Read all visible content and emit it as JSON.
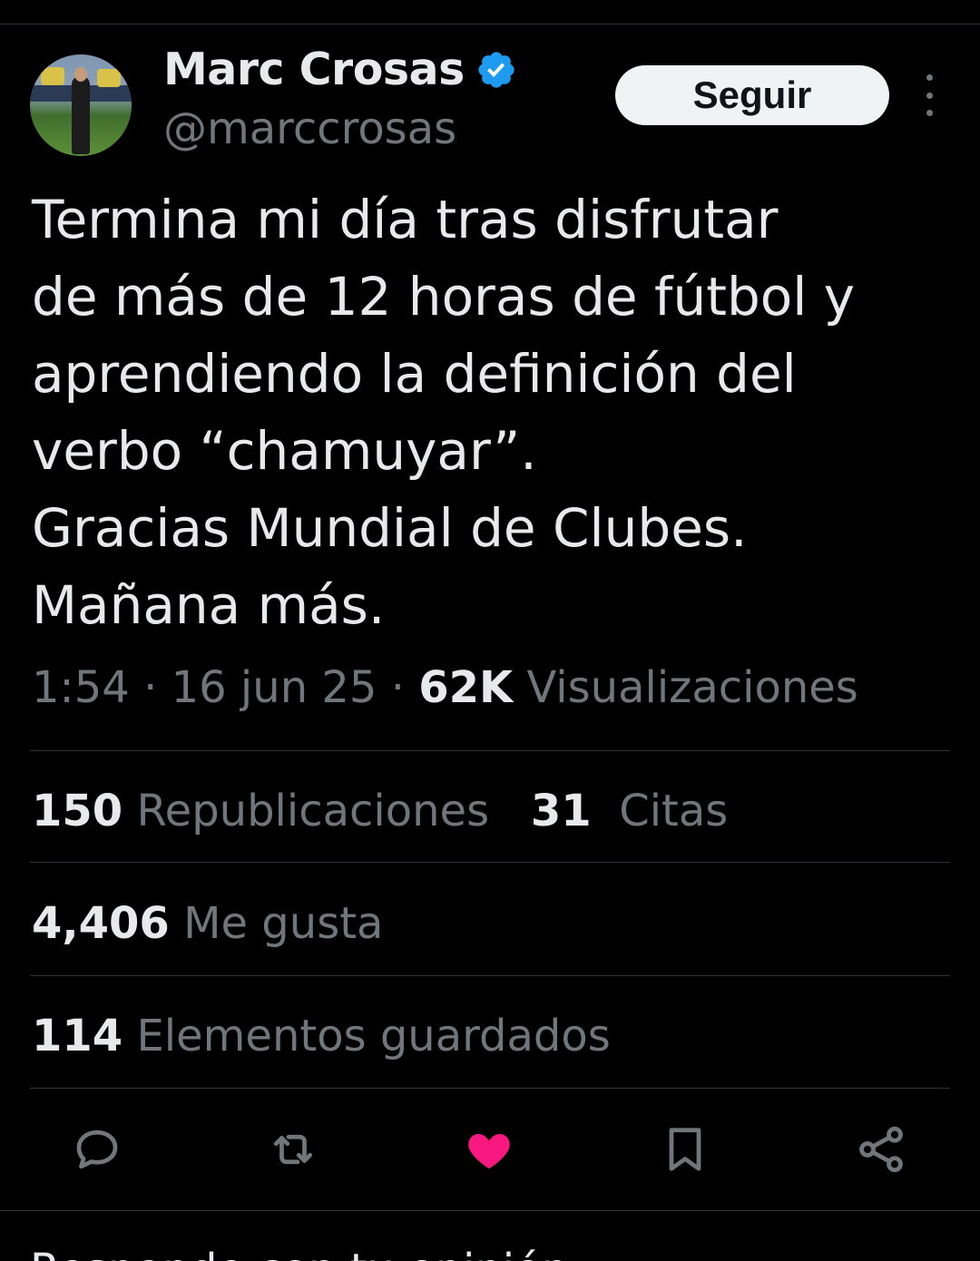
{
  "author": {
    "display_name": "Marc Crosas",
    "handle": "@marccrosas",
    "verified_color": "#1d9bf0"
  },
  "follow_button": {
    "label": "Seguir"
  },
  "more_menu_icon": "more-vertical-icon",
  "tweet": {
    "text": "Termina mi día tras disfrutar\nde más de 12 horas de fútbol y\naprendiendo la definición del\nverbo “chamuyar”.\nGracias Mundial de Clubes.\nMañana más."
  },
  "meta": {
    "time": "1:54",
    "separator": "·",
    "date": "16 jun 25",
    "views_count": "62K",
    "views_label": "Visualizaciones"
  },
  "stats": {
    "reposts_count": "150",
    "reposts_label": "Republicaciones",
    "quotes_count": "31",
    "quotes_label": "Citas",
    "likes_count": "4,406",
    "likes_label": "Me gusta",
    "bookmarks_count": "114",
    "bookmarks_label": "Elementos guardados"
  },
  "actions": [
    {
      "icon": "reply-icon"
    },
    {
      "icon": "repost-icon"
    },
    {
      "icon": "like-icon",
      "active_color": "#f91880"
    },
    {
      "icon": "bookmark-icon"
    },
    {
      "icon": "share-icon"
    }
  ],
  "reply_prompt": {
    "text": "Responde con tu opinión"
  },
  "colors": {
    "background": "#000000",
    "primary_text": "#e7e9ea",
    "secondary_text": "#71767b",
    "divider": "#2f3336",
    "like": "#f91880"
  }
}
